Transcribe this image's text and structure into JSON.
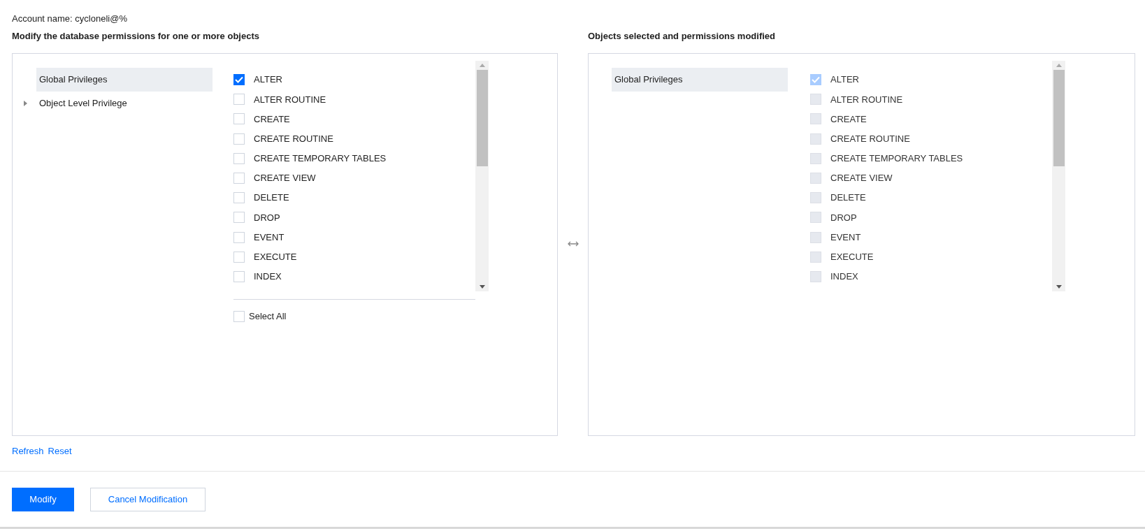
{
  "account_label": "Account name: cycloneli@%",
  "left": {
    "heading": "Modify the database permissions for one or more objects",
    "tree": [
      {
        "label": "Global Privileges",
        "selected": true,
        "expandable": false
      },
      {
        "label": "Object Level Privilege",
        "selected": false,
        "expandable": true
      }
    ],
    "privileges": [
      {
        "label": "ALTER",
        "checked": true
      },
      {
        "label": "ALTER ROUTINE",
        "checked": false
      },
      {
        "label": "CREATE",
        "checked": false
      },
      {
        "label": "CREATE ROUTINE",
        "checked": false
      },
      {
        "label": "CREATE TEMPORARY TABLES",
        "checked": false
      },
      {
        "label": "CREATE VIEW",
        "checked": false
      },
      {
        "label": "DELETE",
        "checked": false
      },
      {
        "label": "DROP",
        "checked": false
      },
      {
        "label": "EVENT",
        "checked": false
      },
      {
        "label": "EXECUTE",
        "checked": false
      },
      {
        "label": "INDEX",
        "checked": false
      }
    ],
    "select_all": {
      "label": "Select All",
      "checked": false
    }
  },
  "right": {
    "heading": "Objects selected and permissions modified",
    "tree": [
      {
        "label": "Global Privileges",
        "selected": true,
        "expandable": false
      }
    ],
    "privileges": [
      {
        "label": "ALTER",
        "checked": true
      },
      {
        "label": "ALTER ROUTINE",
        "checked": false
      },
      {
        "label": "CREATE",
        "checked": false
      },
      {
        "label": "CREATE ROUTINE",
        "checked": false
      },
      {
        "label": "CREATE TEMPORARY TABLES",
        "checked": false
      },
      {
        "label": "CREATE VIEW",
        "checked": false
      },
      {
        "label": "DELETE",
        "checked": false
      },
      {
        "label": "DROP",
        "checked": false
      },
      {
        "label": "EVENT",
        "checked": false
      },
      {
        "label": "EXECUTE",
        "checked": false
      },
      {
        "label": "INDEX",
        "checked": false
      }
    ],
    "disabled": true
  },
  "links": [
    "Refresh",
    "Reset"
  ],
  "buttons": [
    {
      "label": "Modify",
      "kind": "primary"
    },
    {
      "label": "Cancel Modification",
      "kind": "secondary"
    }
  ]
}
